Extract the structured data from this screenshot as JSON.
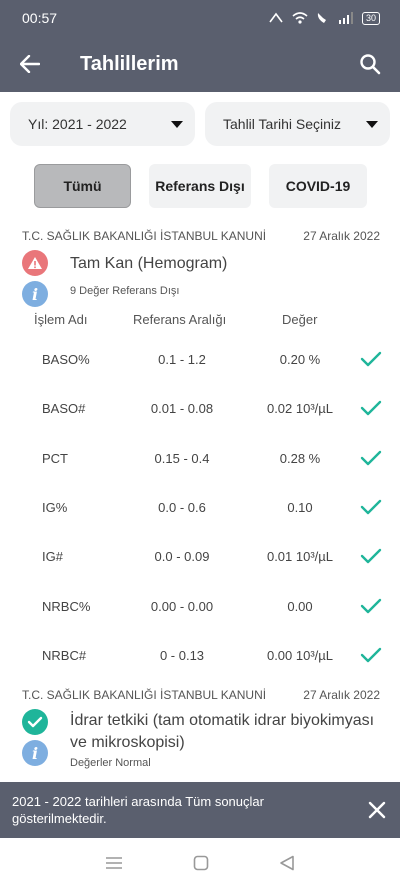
{
  "status": {
    "time": "00:57",
    "battery": "30"
  },
  "appbar": {
    "title": "Tahlillerim"
  },
  "filters": {
    "year": "Yıl: 2021 - 2022",
    "date": "Tahlil Tarihi Seçiniz"
  },
  "tabs": [
    {
      "label": "Tümü",
      "active": true
    },
    {
      "label": "Referans Dışı",
      "active": false
    },
    {
      "label": "COVID-19",
      "active": false
    }
  ],
  "reports": [
    {
      "institution": "T.C. SAĞLIK BAKANLIĞI İSTANBUL KANUNİ",
      "date": "27 Aralık 2022",
      "name": "Tam Kan (Hemogram)",
      "subtitle": "9 Değer Referans Dışı",
      "columns": {
        "name": "İşlem Adı",
        "ref": "Referans Aralığı",
        "value": "Değer"
      },
      "rows": [
        {
          "name": "BASO%",
          "ref": "0.1 - 1.2",
          "value": "0.20 %"
        },
        {
          "name": "BASO#",
          "ref": "0.01 - 0.08",
          "value": "0.02 10³/µL"
        },
        {
          "name": "PCT",
          "ref": "0.15 - 0.4",
          "value": "0.28 %"
        },
        {
          "name": "IG%",
          "ref": "0.0 - 0.6",
          "value": "0.10"
        },
        {
          "name": "IG#",
          "ref": "0.0 - 0.09",
          "value": "0.01 10³/µL"
        },
        {
          "name": "NRBC%",
          "ref": "0.00 - 0.00",
          "value": "0.00"
        },
        {
          "name": "NRBC#",
          "ref": "0 - 0.13",
          "value": "0.00 10³/µL"
        }
      ]
    },
    {
      "institution": "T.C. SAĞLIK BAKANLIĞI İSTANBUL KANUNİ",
      "date": "27 Aralık 2022",
      "name": "İdrar tetkiki (tam otomatik idrar biyokimyası ve mikroskopisi)",
      "subtitle": "Değerler Normal"
    }
  ],
  "snackbar": {
    "message": "2021 - 2022 tarihleri arasında Tüm sonuçlar gösterilmektedir."
  },
  "colors": {
    "header": "#5a5f6e",
    "ok": "#1fb59a",
    "warn": "#e9767a",
    "info": "#7eaee0"
  }
}
